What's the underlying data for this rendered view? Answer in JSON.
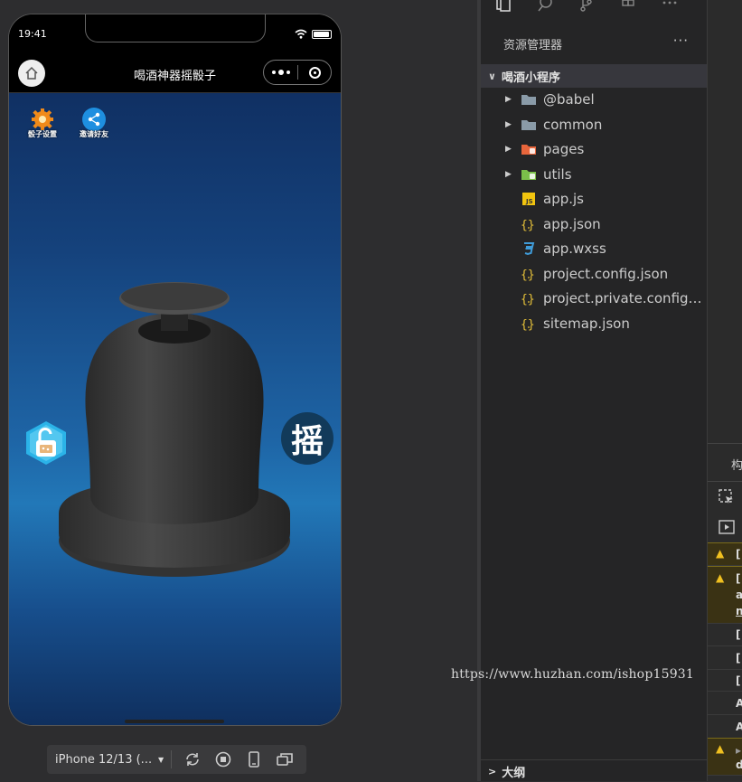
{
  "simulator": {
    "status_time": "19:41",
    "nav_title": "喝酒神器摇骰子",
    "top_buttons": [
      {
        "label": "骰子设置",
        "icon": "gear-icon"
      },
      {
        "label": "邀请好友",
        "icon": "share-icon"
      }
    ],
    "shake_label": "摇",
    "device_label": "iPhone 12/13 (..."
  },
  "explorer": {
    "title": "资源管理器",
    "more": "···",
    "project_name": "喝酒小程序",
    "items": [
      {
        "name": "@babel",
        "type": "folder",
        "icon": "folder-icon"
      },
      {
        "name": "common",
        "type": "folder",
        "icon": "folder-icon"
      },
      {
        "name": "pages",
        "type": "folder",
        "icon": "pages-folder-icon"
      },
      {
        "name": "utils",
        "type": "folder",
        "icon": "utils-folder-icon"
      },
      {
        "name": "app.js",
        "type": "file",
        "icon": "js-file-icon"
      },
      {
        "name": "app.json",
        "type": "file",
        "icon": "json-file-icon"
      },
      {
        "name": "app.wxss",
        "type": "file",
        "icon": "css-file-icon"
      },
      {
        "name": "project.config.json",
        "type": "file",
        "icon": "json-file-icon"
      },
      {
        "name": "project.private.config.js...",
        "type": "file",
        "icon": "json-file-icon"
      },
      {
        "name": "sitemap.json",
        "type": "file",
        "icon": "json-file-icon"
      }
    ],
    "outline_label": "大纲"
  },
  "console": {
    "tab_label": "构",
    "rows": [
      "[",
      "[",
      "a",
      "n",
      "[",
      "[",
      "[",
      "A",
      "A",
      "▸",
      "d"
    ]
  },
  "watermark": "https://www.huzhan.com/ishop15931",
  "colors": {
    "accent_blue": "#2278b8",
    "warn_yellow": "#f0c020",
    "folder_gray": "#8a9ba8",
    "pages_orange": "#e8663c",
    "utils_green": "#7bbf4a",
    "js_yellow": "#f1c40f",
    "json_yellow": "#e8c33a",
    "css_blue": "#3f9bd8"
  }
}
